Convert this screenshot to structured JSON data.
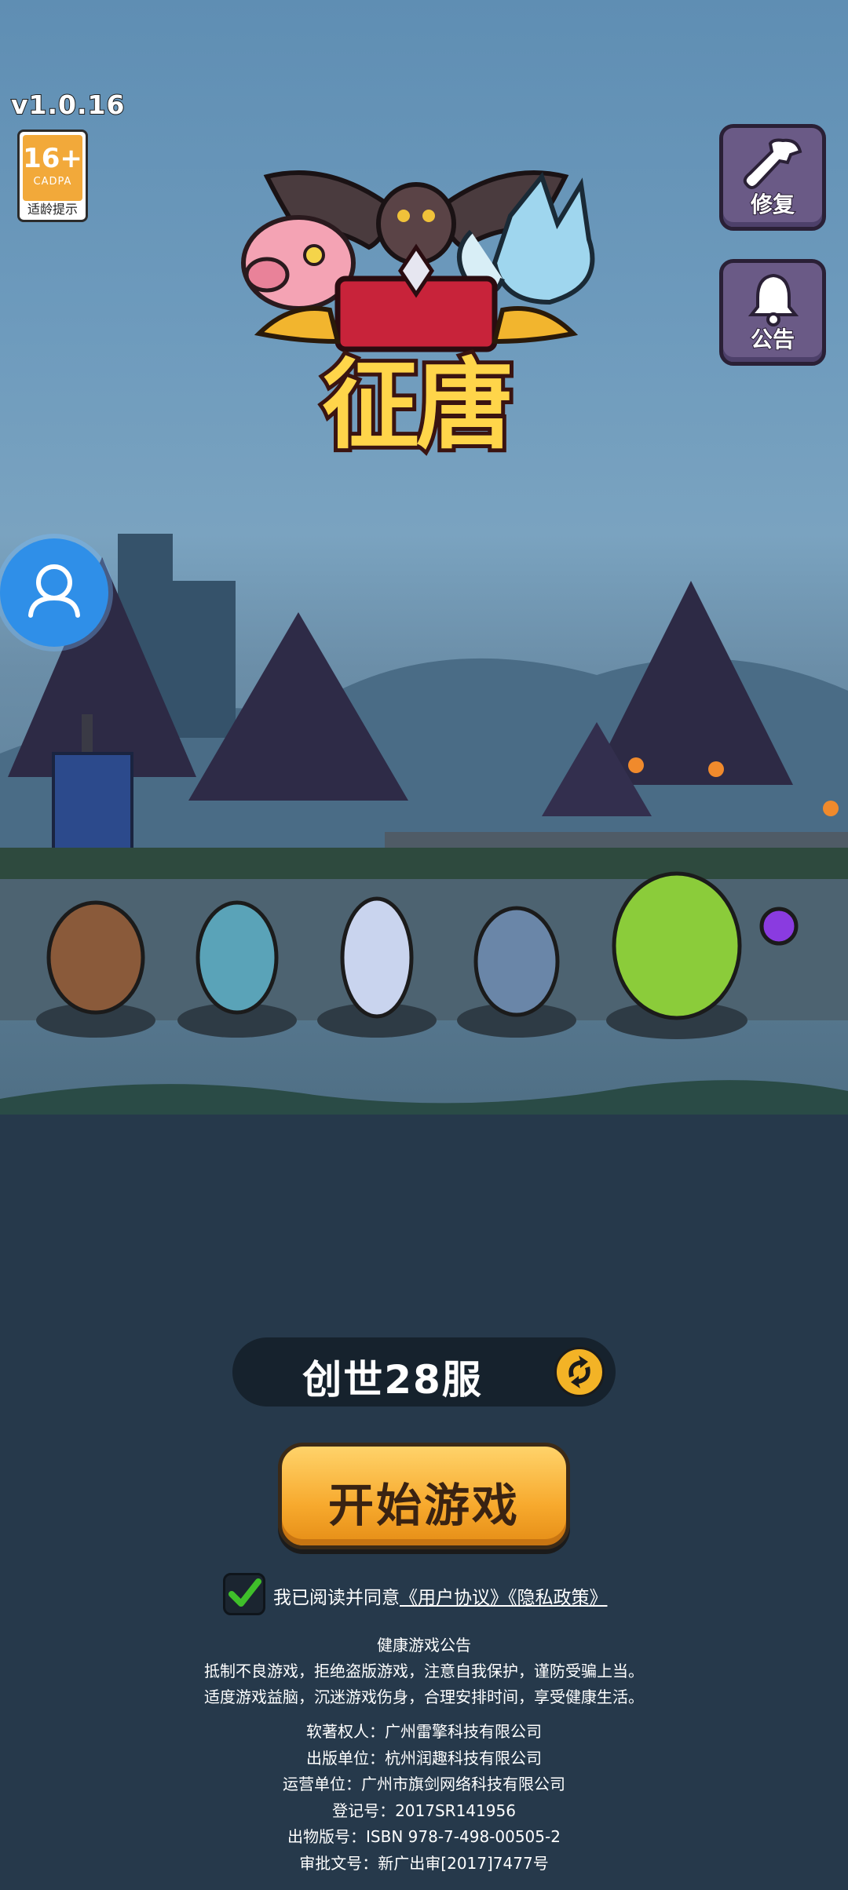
{
  "header": {
    "version": "v1.0.16",
    "age_rating": {
      "number": "16+",
      "org": "CADPA",
      "tip": "适龄提示"
    }
  },
  "logo": {
    "title": "征唐"
  },
  "side_buttons": {
    "repair_label": "修复",
    "notice_label": "公告"
  },
  "server": {
    "name": "创世28服"
  },
  "start": {
    "label": "开始游戏"
  },
  "agreement": {
    "checked": true,
    "prefix": "我已阅读并同意",
    "user_agreement": "《用户协议》",
    "privacy_policy": "《隐私政策》"
  },
  "health_notice": {
    "title": "健康游戏公告",
    "line1": "抵制不良游戏，拒绝盗版游戏，注意自我保护，谨防受骗上当。",
    "line2": "适度游戏益脑，沉迷游戏伤身，合理安排时间，享受健康生活。"
  },
  "credits": {
    "copyright": "软著权人：广州雷擎科技有限公司",
    "publisher": "出版单位：杭州润趣科技有限公司",
    "operator": "运营单位：广州市旗剑网络科技有限公司",
    "registration": "登记号：2017SR141956",
    "isbn": "出物版号：ISBN 978-7-498-00505-2",
    "approval": "审批文号：新广出审[2017]7477号"
  },
  "colors": {
    "start_button": "#f7a92d",
    "panel_button": "#6a5a86",
    "avatar_button": "#2f8fe8",
    "checkbox_mark": "#3fbf2a"
  }
}
